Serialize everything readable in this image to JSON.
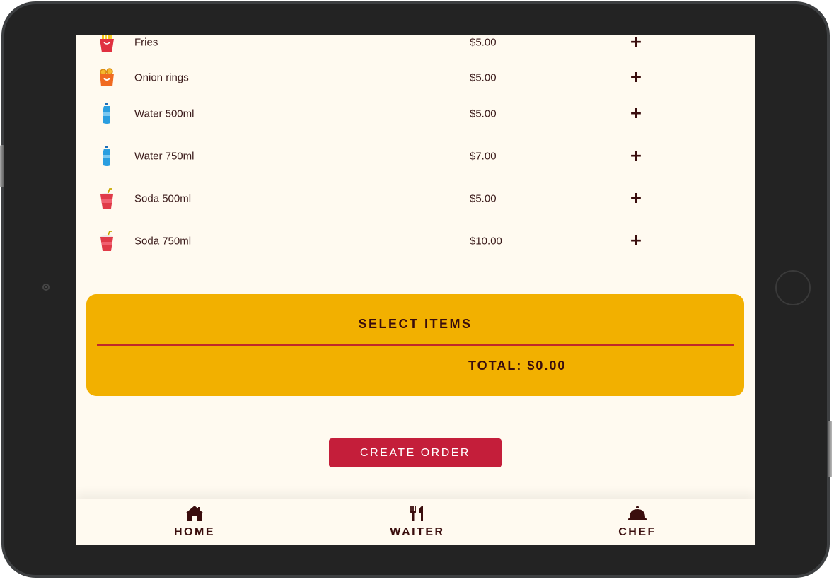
{
  "menu": {
    "items": [
      {
        "name": "Fries",
        "price": "$5.00",
        "icon": "fries-icon",
        "add_label": "+"
      },
      {
        "name": "Onion rings",
        "price": "$5.00",
        "icon": "onion-rings-icon",
        "add_label": "+"
      },
      {
        "name": "Water 500ml",
        "price": "$5.00",
        "icon": "water-bottle-icon",
        "add_label": "+"
      },
      {
        "name": "Water 750ml",
        "price": "$7.00",
        "icon": "water-bottle-icon",
        "add_label": "+"
      },
      {
        "name": "Soda 500ml",
        "price": "$5.00",
        "icon": "soda-cup-icon",
        "add_label": "+"
      },
      {
        "name": "Soda 750ml",
        "price": "$10.00",
        "icon": "soda-cup-icon",
        "add_label": "+"
      }
    ]
  },
  "summary": {
    "title": "SELECT ITEMS",
    "total": "TOTAL: $0.00"
  },
  "actions": {
    "create_order_label": "CREATE ORDER"
  },
  "nav": {
    "items": [
      {
        "label": "HOME",
        "icon": "home-icon"
      },
      {
        "label": "WAITER",
        "icon": "utensils-icon"
      },
      {
        "label": "CHEF",
        "icon": "service-bell-icon"
      }
    ]
  },
  "colors": {
    "background": "#fffaf0",
    "summary_bg": "#f2b000",
    "accent": "#c41e3a",
    "text_dark": "#3a0d0d",
    "divider": "#c0282a",
    "device_frame": "#232323"
  }
}
